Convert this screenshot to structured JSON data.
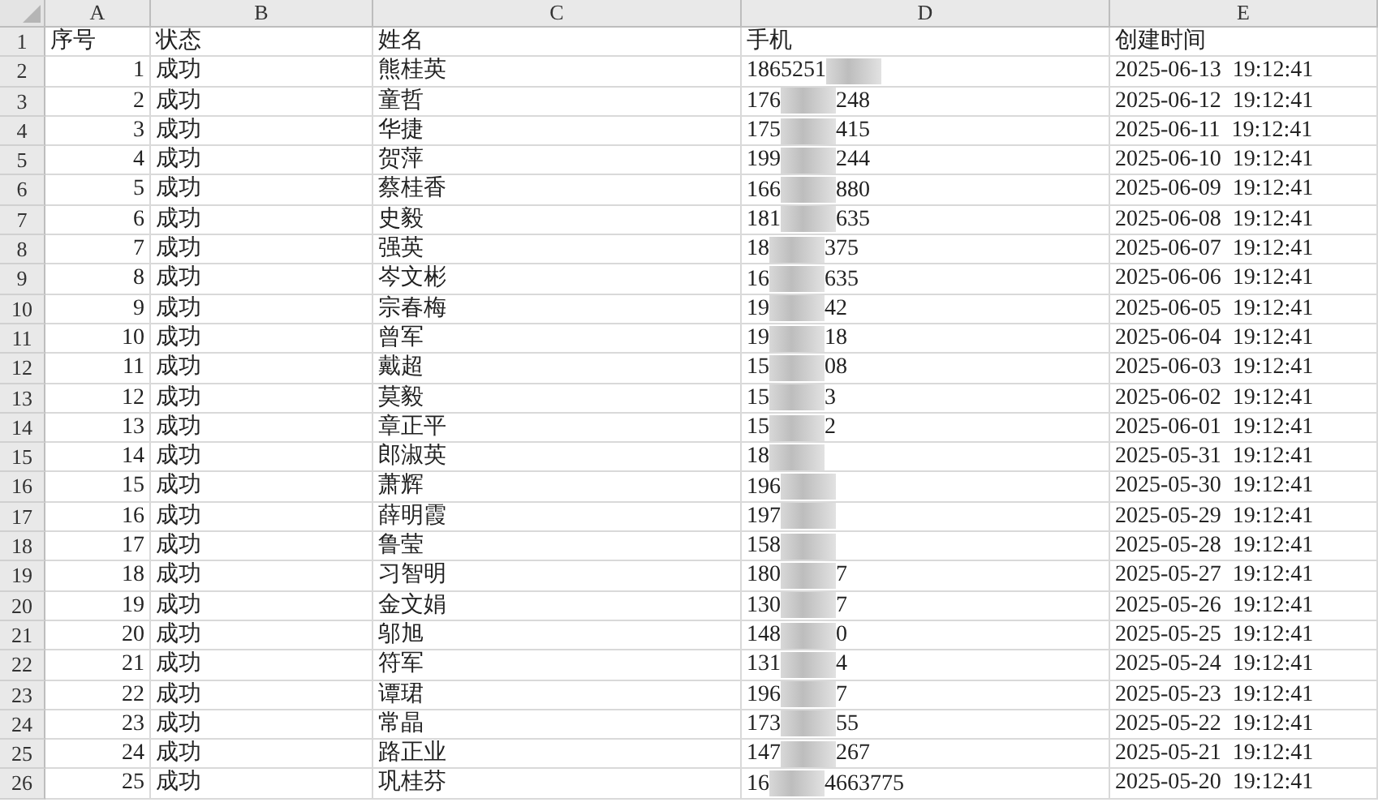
{
  "columns": [
    "A",
    "B",
    "C",
    "D",
    "E"
  ],
  "header_row": {
    "number": "1",
    "cells": [
      "序号",
      "状态",
      "姓名",
      "手机",
      "创建时间"
    ]
  },
  "rows": [
    {
      "number": "2",
      "index": "1",
      "status": "成功",
      "name": "熊桂英",
      "phone_start": "1865251",
      "created": "2025-06-13  19:12:41"
    },
    {
      "number": "3",
      "index": "2",
      "status": "成功",
      "name": "童哲",
      "phone_start": "176",
      "phone_end": "248",
      "created": "2025-06-12  19:12:41"
    },
    {
      "number": "4",
      "index": "3",
      "status": "成功",
      "name": "华捷",
      "phone_start": "175",
      "phone_end": "415",
      "created": "2025-06-11  19:12:41"
    },
    {
      "number": "5",
      "index": "4",
      "status": "成功",
      "name": "贺萍",
      "phone_start": "199",
      "phone_end": "244",
      "created": "2025-06-10  19:12:41"
    },
    {
      "number": "6",
      "index": "5",
      "status": "成功",
      "name": "蔡桂香",
      "phone_start": "166",
      "phone_end": "880",
      "created": "2025-06-09  19:12:41"
    },
    {
      "number": "7",
      "index": "6",
      "status": "成功",
      "name": "史毅",
      "phone_start": "181",
      "phone_end": "635",
      "created": "2025-06-08  19:12:41"
    },
    {
      "number": "8",
      "index": "7",
      "status": "成功",
      "name": "强英",
      "phone_start": "18",
      "phone_end": "375",
      "created": "2025-06-07  19:12:41"
    },
    {
      "number": "9",
      "index": "8",
      "status": "成功",
      "name": "岑文彬",
      "phone_start": "16",
      "phone_end": "635",
      "created": "2025-06-06  19:12:41"
    },
    {
      "number": "10",
      "index": "9",
      "status": "成功",
      "name": "宗春梅",
      "phone_start": "19",
      "phone_end": "42",
      "created": "2025-06-05  19:12:41"
    },
    {
      "number": "11",
      "index": "10",
      "status": "成功",
      "name": "曾军",
      "phone_start": "19",
      "phone_end": "18",
      "created": "2025-06-04  19:12:41"
    },
    {
      "number": "12",
      "index": "11",
      "status": "成功",
      "name": "戴超",
      "phone_start": "15",
      "phone_end": "08",
      "created": "2025-06-03  19:12:41"
    },
    {
      "number": "13",
      "index": "12",
      "status": "成功",
      "name": "莫毅",
      "phone_start": "15",
      "phone_end": "3",
      "created": "2025-06-02  19:12:41"
    },
    {
      "number": "14",
      "index": "13",
      "status": "成功",
      "name": "章正平",
      "phone_start": "15",
      "phone_end": "2",
      "created": "2025-06-01  19:12:41"
    },
    {
      "number": "15",
      "index": "14",
      "status": "成功",
      "name": "郎淑英",
      "phone_start": "18",
      "created": "2025-05-31  19:12:41"
    },
    {
      "number": "16",
      "index": "15",
      "status": "成功",
      "name": "萧辉",
      "phone_start": "196",
      "created": "2025-05-30  19:12:41"
    },
    {
      "number": "17",
      "index": "16",
      "status": "成功",
      "name": "薛明霞",
      "phone_start": "197",
      "created": "2025-05-29  19:12:41"
    },
    {
      "number": "18",
      "index": "17",
      "status": "成功",
      "name": "鲁莹",
      "phone_start": "158",
      "created": "2025-05-28  19:12:41"
    },
    {
      "number": "19",
      "index": "18",
      "status": "成功",
      "name": "习智明",
      "phone_start": "180",
      "phone_end": "7",
      "created": "2025-05-27  19:12:41"
    },
    {
      "number": "20",
      "index": "19",
      "status": "成功",
      "name": "金文娟",
      "phone_start": "130",
      "phone_end": "7",
      "created": "2025-05-26  19:12:41"
    },
    {
      "number": "21",
      "index": "20",
      "status": "成功",
      "name": "邬旭",
      "phone_start": "148",
      "phone_end": "0",
      "created": "2025-05-25  19:12:41"
    },
    {
      "number": "22",
      "index": "21",
      "status": "成功",
      "name": "符军",
      "phone_start": "131",
      "phone_end": "4",
      "created": "2025-05-24  19:12:41"
    },
    {
      "number": "23",
      "index": "22",
      "status": "成功",
      "name": "谭珺",
      "phone_start": "196",
      "phone_end": "7",
      "created": "2025-05-23  19:12:41"
    },
    {
      "number": "24",
      "index": "23",
      "status": "成功",
      "name": "常晶",
      "phone_start": "173",
      "phone_end": "55",
      "created": "2025-05-22  19:12:41"
    },
    {
      "number": "25",
      "index": "24",
      "status": "成功",
      "name": "路正业",
      "phone_start": "147",
      "phone_end": "267",
      "created": "2025-05-21  19:12:41"
    },
    {
      "number": "26",
      "index": "25",
      "status": "成功",
      "name": "巩桂芬",
      "phone_start": "16",
      "phone_end": "4663775",
      "created": "2025-05-20  19:12:41"
    }
  ]
}
